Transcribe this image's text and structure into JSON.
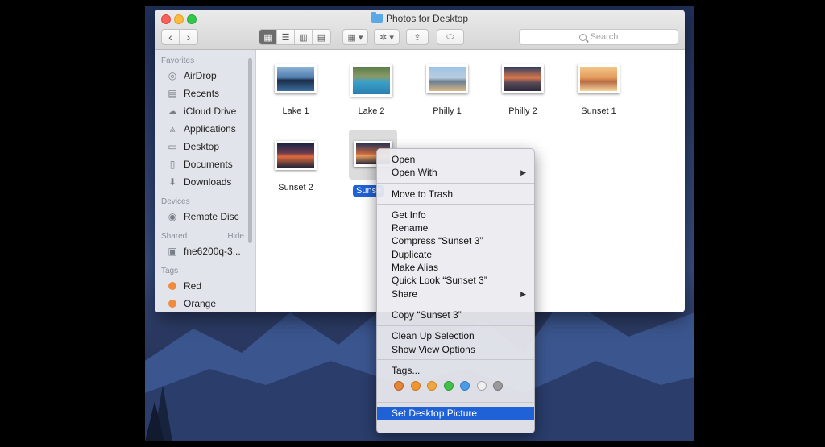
{
  "window": {
    "title": "Photos for Desktop"
  },
  "toolbar": {
    "back": "‹",
    "forward": "›",
    "view_icon": "▦",
    "view_list": "☰",
    "view_column": "▥",
    "view_gallery": "▤",
    "group": "▦ ▾",
    "action": "✲ ▾",
    "share": "⇪",
    "tags": "⬭",
    "search_placeholder": "Search"
  },
  "sidebar": {
    "sections": [
      {
        "header": "Favorites",
        "items": [
          {
            "label": "AirDrop",
            "icon": "airdrop-icon",
            "glyph": "◎"
          },
          {
            "label": "Recents",
            "icon": "recents-icon",
            "glyph": "▤"
          },
          {
            "label": "iCloud Drive",
            "icon": "cloud-icon",
            "glyph": "☁"
          },
          {
            "label": "Applications",
            "icon": "applications-icon",
            "glyph": "⩓"
          },
          {
            "label": "Desktop",
            "icon": "desktop-icon",
            "glyph": "▭"
          },
          {
            "label": "Documents",
            "icon": "documents-icon",
            "glyph": "▯"
          },
          {
            "label": "Downloads",
            "icon": "downloads-icon",
            "glyph": "⬇"
          }
        ]
      },
      {
        "header": "Devices",
        "items": [
          {
            "label": "Remote Disc",
            "icon": "disc-icon",
            "glyph": "◉"
          }
        ]
      },
      {
        "header": "Shared",
        "hide": "Hide",
        "items": [
          {
            "label": "fne6200q-3...",
            "icon": "computer-icon",
            "glyph": "▣"
          }
        ]
      },
      {
        "header": "Tags",
        "items": [
          {
            "label": "Red",
            "tag_color": "#f08a3c"
          },
          {
            "label": "Orange",
            "tag_color": "#f08a3c"
          }
        ]
      }
    ]
  },
  "files": [
    {
      "name": "Lake 1",
      "img": "img-lake1"
    },
    {
      "name": "Lake 2",
      "img": "img-lake2"
    },
    {
      "name": "Philly 1",
      "img": "img-philly1"
    },
    {
      "name": "Philly 2",
      "img": "img-philly2"
    },
    {
      "name": "Sunset 1",
      "img": "img-sunset1"
    },
    {
      "name": "Sunset 2",
      "img": "img-sunset2"
    },
    {
      "name": "Sunse",
      "img": "img-sunset3",
      "selected": true
    }
  ],
  "context_menu": {
    "groups": [
      [
        {
          "label": "Open"
        },
        {
          "label": "Open With",
          "submenu": "▶"
        }
      ],
      [
        {
          "label": "Move to Trash"
        }
      ],
      [
        {
          "label": "Get Info"
        },
        {
          "label": "Rename"
        },
        {
          "label": "Compress “Sunset 3”"
        },
        {
          "label": "Duplicate"
        },
        {
          "label": "Make Alias"
        },
        {
          "label": "Quick Look “Sunset 3”"
        },
        {
          "label": "Share",
          "submenu": "▶"
        }
      ],
      [
        {
          "label": "Copy “Sunset 3”"
        }
      ],
      [
        {
          "label": "Clean Up Selection"
        },
        {
          "label": "Show View Options"
        }
      ],
      [
        {
          "label": "Tags..."
        }
      ]
    ],
    "tag_colors": [
      "#e5853a",
      "#f39433",
      "#f2a640",
      "#44c04a",
      "#4a9be8",
      "#f0f0f4",
      "#9a9a9c"
    ],
    "last_item": "Set Desktop Picture"
  }
}
